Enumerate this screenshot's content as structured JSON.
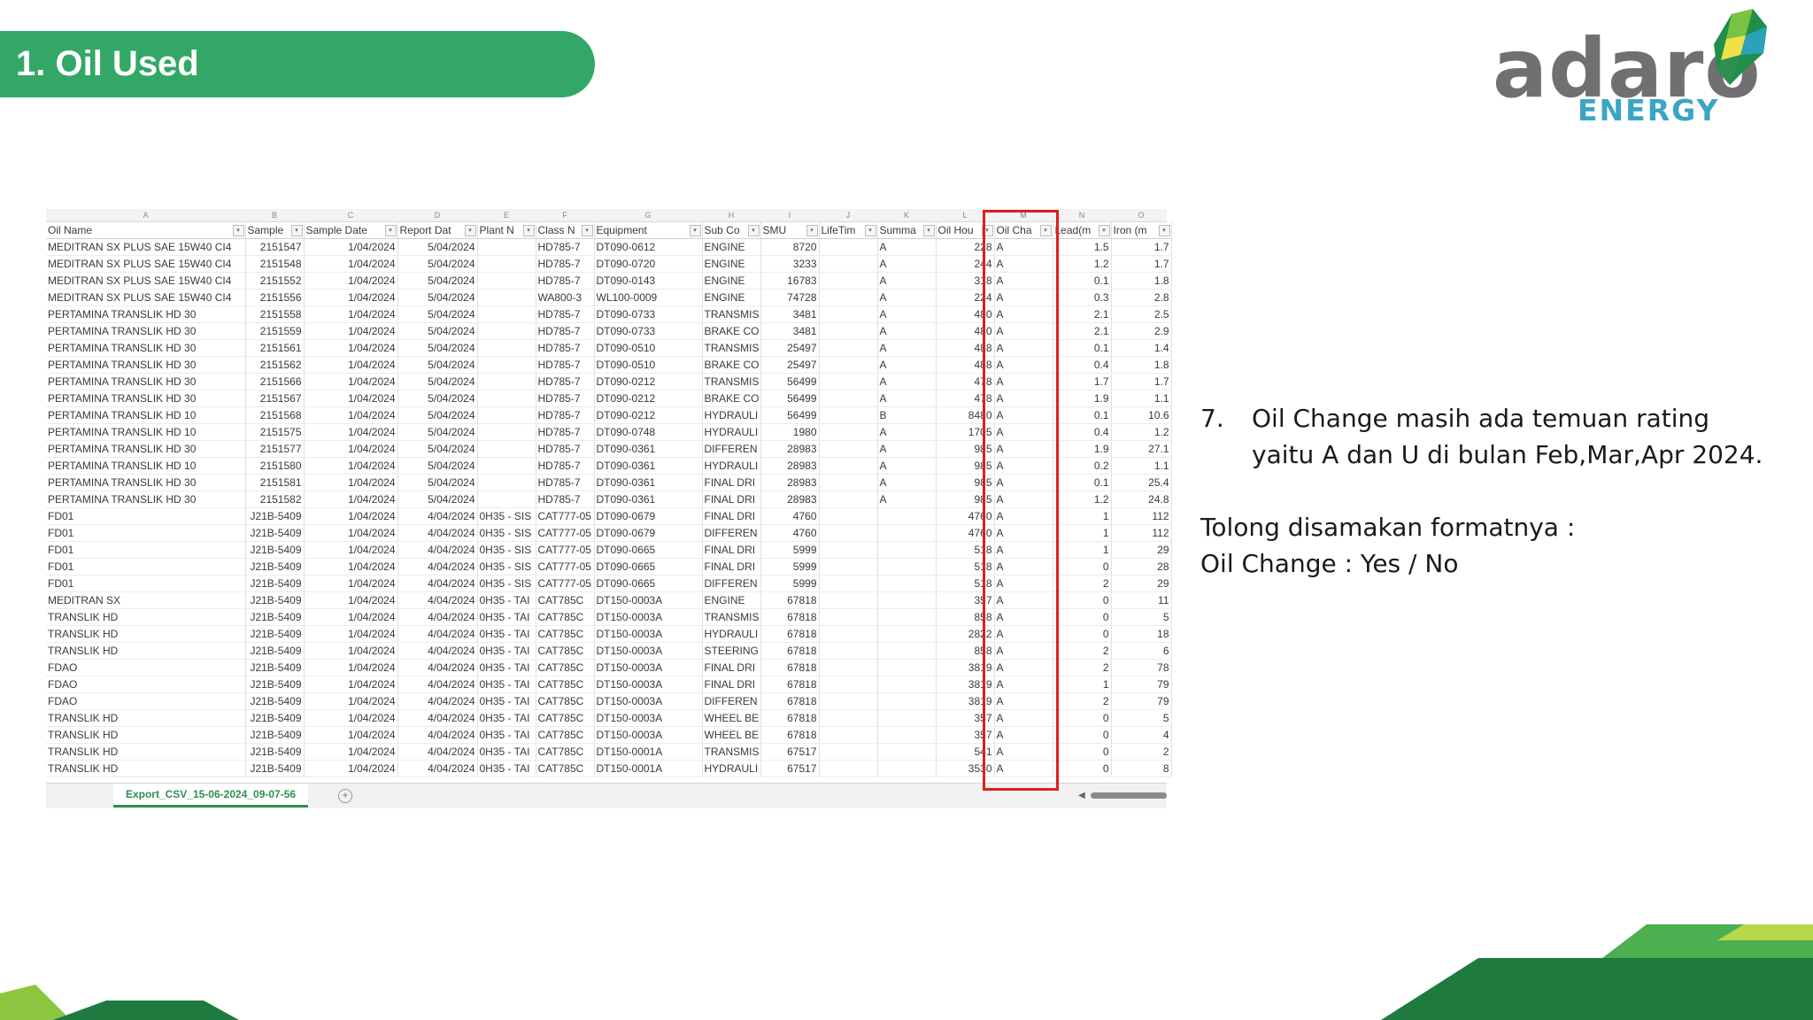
{
  "title": "1. Oil Used",
  "logo": {
    "word": "adaro",
    "sub": "ENERGY"
  },
  "colors": {
    "banner": "#33a866",
    "highlight": "#e0201b",
    "logo_text": "#707070",
    "logo_sub": "#3aa6c4"
  },
  "sheet": {
    "column_letters": [
      "A",
      "B",
      "C",
      "D",
      "E",
      "F",
      "G",
      "H",
      "I",
      "J",
      "K",
      "L",
      "M",
      "N",
      "O"
    ],
    "headers": [
      "Oil Name",
      "Sample",
      "Sample Date",
      "Report Dat",
      "Plant N",
      "Class N",
      "Equipment",
      "Sub Co",
      "SMU",
      "LifeTim",
      "Summa",
      "Oil Hou",
      "Oil Cha",
      "Lead(m",
      "Iron (m"
    ],
    "rows": [
      [
        "MEDITRAN SX PLUS SAE 15W40 CI4",
        "2151547",
        "1/04/2024",
        "5/04/2024",
        "",
        "HD785-7",
        "DT090-0612",
        "ENGINE",
        "8720",
        "",
        "A",
        "228",
        "A",
        "1.5",
        "1.7"
      ],
      [
        "MEDITRAN SX PLUS SAE 15W40 CI4",
        "2151548",
        "1/04/2024",
        "5/04/2024",
        "",
        "HD785-7",
        "DT090-0720",
        "ENGINE",
        "3233",
        "",
        "A",
        "244",
        "A",
        "1.2",
        "1.7"
      ],
      [
        "MEDITRAN SX PLUS SAE 15W40 CI4",
        "2151552",
        "1/04/2024",
        "5/04/2024",
        "",
        "HD785-7",
        "DT090-0143",
        "ENGINE",
        "16783",
        "",
        "A",
        "318",
        "A",
        "0.1",
        "1.8"
      ],
      [
        "MEDITRAN SX PLUS SAE 15W40 CI4",
        "2151556",
        "1/04/2024",
        "5/04/2024",
        "",
        "WA800-3",
        "WL100-0009",
        "ENGINE",
        "74728",
        "",
        "A",
        "224",
        "A",
        "0.3",
        "2.8"
      ],
      [
        "PERTAMINA TRANSLIK HD 30",
        "2151558",
        "1/04/2024",
        "5/04/2024",
        "",
        "HD785-7",
        "DT090-0733",
        "TRANSMIS",
        "3481",
        "",
        "A",
        "480",
        "A",
        "2.1",
        "2.5"
      ],
      [
        "PERTAMINA TRANSLIK HD 30",
        "2151559",
        "1/04/2024",
        "5/04/2024",
        "",
        "HD785-7",
        "DT090-0733",
        "BRAKE CO",
        "3481",
        "",
        "A",
        "480",
        "A",
        "2.1",
        "2.9"
      ],
      [
        "PERTAMINA TRANSLIK HD 30",
        "2151561",
        "1/04/2024",
        "5/04/2024",
        "",
        "HD785-7",
        "DT090-0510",
        "TRANSMIS",
        "25497",
        "",
        "A",
        "488",
        "A",
        "0.1",
        "1.4"
      ],
      [
        "PERTAMINA TRANSLIK HD 30",
        "2151562",
        "1/04/2024",
        "5/04/2024",
        "",
        "HD785-7",
        "DT090-0510",
        "BRAKE CO",
        "25497",
        "",
        "A",
        "488",
        "A",
        "0.4",
        "1.8"
      ],
      [
        "PERTAMINA TRANSLIK HD 30",
        "2151566",
        "1/04/2024",
        "5/04/2024",
        "",
        "HD785-7",
        "DT090-0212",
        "TRANSMIS",
        "56499",
        "",
        "A",
        "478",
        "A",
        "1.7",
        "1.7"
      ],
      [
        "PERTAMINA TRANSLIK HD 30",
        "2151567",
        "1/04/2024",
        "5/04/2024",
        "",
        "HD785-7",
        "DT090-0212",
        "BRAKE CO",
        "56499",
        "",
        "A",
        "478",
        "A",
        "1.9",
        "1.1"
      ],
      [
        "PERTAMINA TRANSLIK HD 10",
        "2151568",
        "1/04/2024",
        "5/04/2024",
        "",
        "HD785-7",
        "DT090-0212",
        "HYDRAULI",
        "56499",
        "",
        "B",
        "8480",
        "A",
        "0.1",
        "10.6"
      ],
      [
        "PERTAMINA TRANSLIK HD 10",
        "2151575",
        "1/04/2024",
        "5/04/2024",
        "",
        "HD785-7",
        "DT090-0748",
        "HYDRAULI",
        "1980",
        "",
        "A",
        "1705",
        "A",
        "0.4",
        "1.2"
      ],
      [
        "PERTAMINA TRANSLIK HD 30",
        "2151577",
        "1/04/2024",
        "5/04/2024",
        "",
        "HD785-7",
        "DT090-0361",
        "DIFFEREN",
        "28983",
        "",
        "A",
        "985",
        "A",
        "1.9",
        "27.1"
      ],
      [
        "PERTAMINA TRANSLIK HD 10",
        "2151580",
        "1/04/2024",
        "5/04/2024",
        "",
        "HD785-7",
        "DT090-0361",
        "HYDRAULI",
        "28983",
        "",
        "A",
        "985",
        "A",
        "0.2",
        "1.1"
      ],
      [
        "PERTAMINA TRANSLIK HD 30",
        "2151581",
        "1/04/2024",
        "5/04/2024",
        "",
        "HD785-7",
        "DT090-0361",
        "FINAL DRI",
        "28983",
        "",
        "A",
        "985",
        "A",
        "0.1",
        "25.4"
      ],
      [
        "PERTAMINA TRANSLIK HD 30",
        "2151582",
        "1/04/2024",
        "5/04/2024",
        "",
        "HD785-7",
        "DT090-0361",
        "FINAL DRI",
        "28983",
        "",
        "A",
        "985",
        "A",
        "1.2",
        "24.8"
      ],
      [
        "FD01",
        "J21B-5409",
        "1/04/2024",
        "4/04/2024",
        "0H35 - SIS",
        "CAT777-05",
        "DT090-0679",
        "FINAL DRI",
        "4760",
        "",
        "",
        "4760",
        "A",
        "1",
        "112"
      ],
      [
        "FD01",
        "J21B-5409",
        "1/04/2024",
        "4/04/2024",
        "0H35 - SIS",
        "CAT777-05",
        "DT090-0679",
        "DIFFEREN",
        "4760",
        "",
        "",
        "4760",
        "A",
        "1",
        "112"
      ],
      [
        "FD01",
        "J21B-5409",
        "1/04/2024",
        "4/04/2024",
        "0H35 - SIS",
        "CAT777-05",
        "DT090-0665",
        "FINAL DRI",
        "5999",
        "",
        "",
        "518",
        "A",
        "1",
        "29"
      ],
      [
        "FD01",
        "J21B-5409",
        "1/04/2024",
        "4/04/2024",
        "0H35 - SIS",
        "CAT777-05",
        "DT090-0665",
        "FINAL DRI",
        "5999",
        "",
        "",
        "518",
        "A",
        "0",
        "28"
      ],
      [
        "FD01",
        "J21B-5409",
        "1/04/2024",
        "4/04/2024",
        "0H35 - SIS",
        "CAT777-05",
        "DT090-0665",
        "DIFFEREN",
        "5999",
        "",
        "",
        "518",
        "A",
        "2",
        "29"
      ],
      [
        "MEDITRAN SX",
        "J21B-5409",
        "1/04/2024",
        "4/04/2024",
        "0H35 - TAI",
        "CAT785C",
        "DT150-0003A",
        "ENGINE",
        "67818",
        "",
        "",
        "357",
        "A",
        "0",
        "11"
      ],
      [
        "TRANSLIK HD",
        "J21B-5409",
        "1/04/2024",
        "4/04/2024",
        "0H35 - TAI",
        "CAT785C",
        "DT150-0003A",
        "TRANSMIS",
        "67818",
        "",
        "",
        "858",
        "A",
        "0",
        "5"
      ],
      [
        "TRANSLIK HD",
        "J21B-5409",
        "1/04/2024",
        "4/04/2024",
        "0H35 - TAI",
        "CAT785C",
        "DT150-0003A",
        "HYDRAULI",
        "67818",
        "",
        "",
        "2822",
        "A",
        "0",
        "18"
      ],
      [
        "TRANSLIK HD",
        "J21B-5409",
        "1/04/2024",
        "4/04/2024",
        "0H35 - TAI",
        "CAT785C",
        "DT150-0003A",
        "STEERING",
        "67818",
        "",
        "",
        "858",
        "A",
        "2",
        "6"
      ],
      [
        "FDAO",
        "J21B-5409",
        "1/04/2024",
        "4/04/2024",
        "0H35 - TAI",
        "CAT785C",
        "DT150-0003A",
        "FINAL DRI",
        "67818",
        "",
        "",
        "3819",
        "A",
        "2",
        "78"
      ],
      [
        "FDAO",
        "J21B-5409",
        "1/04/2024",
        "4/04/2024",
        "0H35 - TAI",
        "CAT785C",
        "DT150-0003A",
        "FINAL DRI",
        "67818",
        "",
        "",
        "3819",
        "A",
        "1",
        "79"
      ],
      [
        "FDAO",
        "J21B-5409",
        "1/04/2024",
        "4/04/2024",
        "0H35 - TAI",
        "CAT785C",
        "DT150-0003A",
        "DIFFEREN",
        "67818",
        "",
        "",
        "3819",
        "A",
        "2",
        "79"
      ],
      [
        "TRANSLIK HD",
        "J21B-5409",
        "1/04/2024",
        "4/04/2024",
        "0H35 - TAI",
        "CAT785C",
        "DT150-0003A",
        "WHEEL BE",
        "67818",
        "",
        "",
        "357",
        "A",
        "0",
        "5"
      ],
      [
        "TRANSLIK HD",
        "J21B-5409",
        "1/04/2024",
        "4/04/2024",
        "0H35 - TAI",
        "CAT785C",
        "DT150-0003A",
        "WHEEL BE",
        "67818",
        "",
        "",
        "357",
        "A",
        "0",
        "4"
      ],
      [
        "TRANSLIK HD",
        "J21B-5409",
        "1/04/2024",
        "4/04/2024",
        "0H35 - TAI",
        "CAT785C",
        "DT150-0001A",
        "TRANSMIS",
        "67517",
        "",
        "",
        "541",
        "A",
        "0",
        "2"
      ],
      [
        "TRANSLIK HD",
        "J21B-5409",
        "1/04/2024",
        "4/04/2024",
        "0H35 - TAI",
        "CAT785C",
        "DT150-0001A",
        "HYDRAULI",
        "67517",
        "",
        "",
        "3530",
        "A",
        "0",
        "8"
      ]
    ],
    "sheet_tab": "Export_CSV_15-06-2024_09-07-56",
    "add_sheet": "+"
  },
  "note": {
    "number": "7.",
    "text": "Oil Change masih ada temuan rating yaitu A dan U di bulan Feb,Mar,Apr 2024.",
    "line1": "Tolong disamakan formatnya :",
    "line2": "Oil Change : Yes / No"
  }
}
